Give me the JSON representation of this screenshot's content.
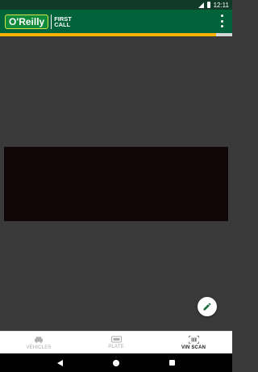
{
  "status_bar": {
    "time": "12:11",
    "icons": [
      "wifi-icon",
      "battery-icon"
    ]
  },
  "app_bar": {
    "brand_name": "O'Reilly",
    "product_line1": "FIRST",
    "product_line2": "CALL",
    "menu_icon": "more-vert-icon"
  },
  "progress": {
    "value": 0.93,
    "color": "#f5b301"
  },
  "scanner": {
    "fab_icon": "pencil-icon"
  },
  "bottom_nav": {
    "items": [
      {
        "label": "VEHICLES",
        "icon": "car-icon",
        "active": false
      },
      {
        "label": "PLATE",
        "icon": "license-plate-icon",
        "active": false
      },
      {
        "label": "VIN SCAN",
        "icon": "barcode-icon",
        "active": true
      }
    ]
  },
  "colors": {
    "brand_green": "#00633a",
    "status_green": "#0f3b28",
    "accent_yellow": "#f5b301",
    "camera_background": "#3a3a3a"
  }
}
